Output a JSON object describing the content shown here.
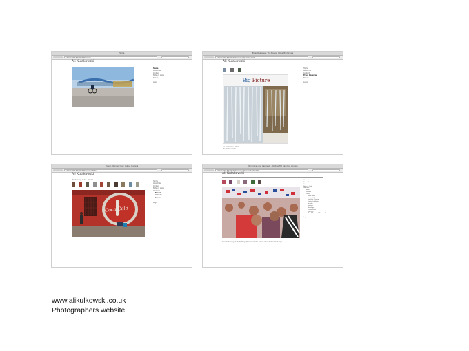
{
  "win1": {
    "title": "Home",
    "url": "http://www.alikulkowski.co.uk/",
    "site": "Ali Kulakowski",
    "nav": [
      "Home",
      "About Me",
      "Contact",
      "Notes & Links",
      "Shows",
      "",
      "Login"
    ]
  },
  "win2": {
    "title": "Press Releases - The Boston Globe Big Picture",
    "url": "http://www.alikulkowski.co.uk/the-big-picture/",
    "site": "Ali Kulakowski",
    "nav": [
      "Home",
      "About Me",
      "Contact",
      "Press Coverage",
      "Shows",
      "",
      "Login"
    ],
    "article_title_1": "Big",
    "article_title_2": "Picture",
    "captions": [
      "Ice formations, 2013",
      "the Boston Globe"
    ]
  },
  "win3": {
    "title": "Travel - Windsor Bay, Cuba - Havana",
    "url": "http://www.alikulkowski.co.uk/travel/",
    "site": "Ali Kulakowski",
    "subtitle": "Windsor Bay, Cuba - Havana",
    "nav": [
      "Home",
      "About Me",
      "Contact",
      "Notes & Links",
      "Galleries",
      "Travel",
      "Portraits",
      "Events",
      "",
      "Login"
    ],
    "cola_text": "Coca-Cola"
  },
  "win4": {
    "title": "Mardi Gras and Carnivals - Notting Hill Carnival, London",
    "url": "http://www.alikulkowski.co.uk/mardi-gras-carnivals/",
    "site": "Ali Kulakowski",
    "nav": [
      "Home",
      "About Me",
      "Contact",
      "Notes & Links",
      "Galleries",
      "Travel",
      "Portraits",
      "Events",
      "Mardi Gras",
      "Notting Hill",
      "Brazilian Carnival",
      "Carnival of Venice",
      "Parades",
      "Festivals",
      "Weddings",
      "Celebrations",
      "Concerts",
      "Mardi Gras and Carnivals",
      "",
      "Login"
    ],
    "caption": "Crowds dancing at the Notting Hill Carnival, the largest street festival in Europe"
  },
  "footer": {
    "line1": "www.alikulkowski.co.uk",
    "line2": "Photographers website"
  }
}
